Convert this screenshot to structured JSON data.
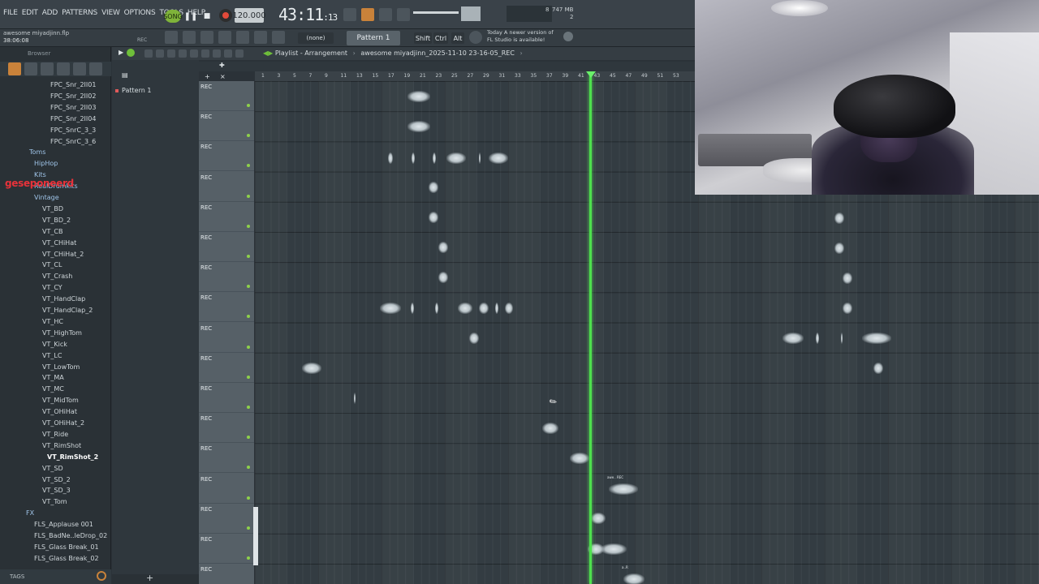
{
  "menu": [
    "FILE",
    "EDIT",
    "ADD",
    "PATTERNS",
    "VIEW",
    "OPTIONS",
    "TOOLS",
    "HELP"
  ],
  "transport": {
    "song_label": "SONG",
    "tempo": "120.000",
    "clock_main": "43:11",
    "clock_sub": ":13"
  },
  "memory": {
    "line1": "747 MB",
    "line2": "2",
    "cpu": "8"
  },
  "project": {
    "file": "awesome miyadjinn.flp",
    "time": "38:06:08",
    "rec": "REC"
  },
  "toolbar": {
    "pattern_none": "(none)",
    "pattern_selected": "Pattern 1",
    "shift": "Shift",
    "ctrl": "Ctrl",
    "alt": "Alt"
  },
  "news": {
    "line1": "Today  A newer version of",
    "line2": "FL Studio is available!"
  },
  "browser": {
    "title": "Browser",
    "overlay": "geseponeerd",
    "tags_label": "TAGS",
    "items": [
      {
        "label": "FPC_Snr_2II01",
        "kind": "file"
      },
      {
        "label": "FPC_Snr_2II02",
        "kind": "file"
      },
      {
        "label": "FPC_Snr_2II03",
        "kind": "file"
      },
      {
        "label": "FPC_Snr_2II04",
        "kind": "file"
      },
      {
        "label": "FPC_SnrC_3_3",
        "kind": "file"
      },
      {
        "label": "FPC_SnrC_3_6",
        "kind": "file"
      },
      {
        "label": "Toms",
        "kind": "folder"
      },
      {
        "label": "HipHop",
        "kind": "folder"
      },
      {
        "label": "Kits",
        "kind": "folder"
      },
      {
        "label": "RealDrumkits",
        "kind": "folder"
      },
      {
        "label": "Vintage",
        "kind": "folder"
      },
      {
        "label": "VT_BD",
        "kind": "file"
      },
      {
        "label": "VT_BD_2",
        "kind": "file"
      },
      {
        "label": "VT_CB",
        "kind": "file"
      },
      {
        "label": "VT_CHiHat",
        "kind": "file"
      },
      {
        "label": "VT_CHiHat_2",
        "kind": "file"
      },
      {
        "label": "VT_CL",
        "kind": "file"
      },
      {
        "label": "VT_Crash",
        "kind": "file"
      },
      {
        "label": "VT_CY",
        "kind": "file"
      },
      {
        "label": "VT_HandClap",
        "kind": "file"
      },
      {
        "label": "VT_HandClap_2",
        "kind": "file"
      },
      {
        "label": "VT_HC",
        "kind": "file"
      },
      {
        "label": "VT_HighTom",
        "kind": "file"
      },
      {
        "label": "VT_Kick",
        "kind": "file"
      },
      {
        "label": "VT_LC",
        "kind": "file"
      },
      {
        "label": "VT_LowTom",
        "kind": "file"
      },
      {
        "label": "VT_MA",
        "kind": "file"
      },
      {
        "label": "VT_MC",
        "kind": "file"
      },
      {
        "label": "VT_MidTom",
        "kind": "file"
      },
      {
        "label": "VT_OHiHat",
        "kind": "file"
      },
      {
        "label": "VT_OHiHat_2",
        "kind": "file"
      },
      {
        "label": "VT_Ride",
        "kind": "file"
      },
      {
        "label": "VT_RimShot",
        "kind": "file"
      },
      {
        "label": "VT_RimShot_2",
        "kind": "file"
      },
      {
        "label": "VT_SD",
        "kind": "file"
      },
      {
        "label": "VT_SD_2",
        "kind": "file"
      },
      {
        "label": "VT_SD_3",
        "kind": "file"
      },
      {
        "label": "VT_Tom",
        "kind": "file"
      },
      {
        "label": "FX",
        "kind": "folder"
      },
      {
        "label": "FLS_Applause 001",
        "kind": "file"
      },
      {
        "label": "FLS_BadNe..leDrop_02",
        "kind": "file"
      },
      {
        "label": "FLS_Glass Break_01",
        "kind": "file"
      },
      {
        "label": "FLS_Glass Break_02",
        "kind": "file"
      }
    ]
  },
  "picker": {
    "pattern": "Pattern 1"
  },
  "playlist": {
    "label": "Playlist - Arrangement",
    "file": "awesome miyadjinn_2025-11-10 23-16-05_REC",
    "ruler": [
      "1",
      "3",
      "5",
      "7",
      "9",
      "11",
      "13",
      "15",
      "17",
      "19",
      "21",
      "23",
      "25",
      "27",
      "29",
      "31",
      "33",
      "35",
      "37",
      "39",
      "41",
      "43",
      "45",
      "47",
      "49",
      "51",
      "53"
    ],
    "track_label": "REC",
    "clip_label": "awe.. REC",
    "clip_label_2": "a..R"
  },
  "colors": {
    "accent_green": "#4ee04e",
    "rec_red": "#e24a3a",
    "song_green": "#7fb33a",
    "overlay_red": "#e8323a"
  }
}
